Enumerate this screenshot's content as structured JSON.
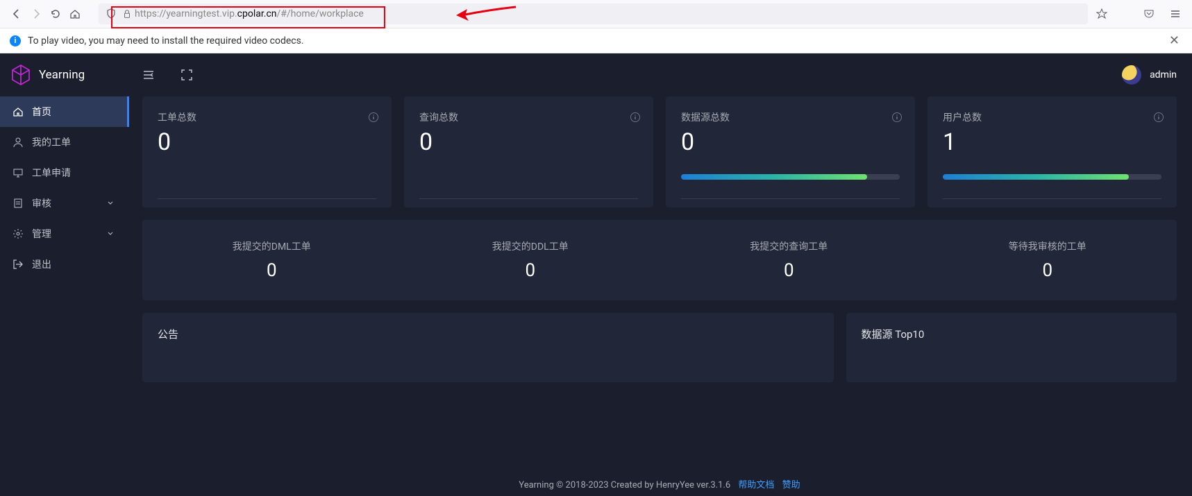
{
  "browser": {
    "url_prefix": "https://yearningtest.vip.",
    "url_mid": "cpolar.cn",
    "url_suffix": "/#/home/workplace"
  },
  "notice": "To play video, you may need to install the required video codecs.",
  "app_name": "Yearning",
  "sidebar": [
    {
      "label": "首页",
      "icon": "home",
      "chev": false,
      "active": true
    },
    {
      "label": "我的工单",
      "icon": "user",
      "chev": false,
      "active": false
    },
    {
      "label": "工单申请",
      "icon": "monitor",
      "chev": false,
      "active": false
    },
    {
      "label": "审核",
      "icon": "clipboard",
      "chev": true,
      "active": false
    },
    {
      "label": "管理",
      "icon": "gear",
      "chev": true,
      "active": false
    },
    {
      "label": "退出",
      "icon": "logout",
      "chev": false,
      "active": false
    }
  ],
  "user": "admin",
  "stats": [
    {
      "title": "工单总数",
      "value": "0",
      "bar": null
    },
    {
      "title": "查询总数",
      "value": "0",
      "bar": null
    },
    {
      "title": "数据源总数",
      "value": "0",
      "bar": 85
    },
    {
      "title": "用户总数",
      "value": "1",
      "bar": 85
    }
  ],
  "subs": [
    {
      "title": "我提交的DML工单",
      "value": "0"
    },
    {
      "title": "我提交的DDL工单",
      "value": "0"
    },
    {
      "title": "我提交的查询工单",
      "value": "0"
    },
    {
      "title": "等待我审核的工单",
      "value": "0"
    }
  ],
  "panels": {
    "left": "公告",
    "right": "数据源 Top10"
  },
  "footer": {
    "text": "Yearning © 2018-2023 Created by HenryYee ver.3.1.6",
    "link1": "帮助文档",
    "link2": "赞助"
  }
}
